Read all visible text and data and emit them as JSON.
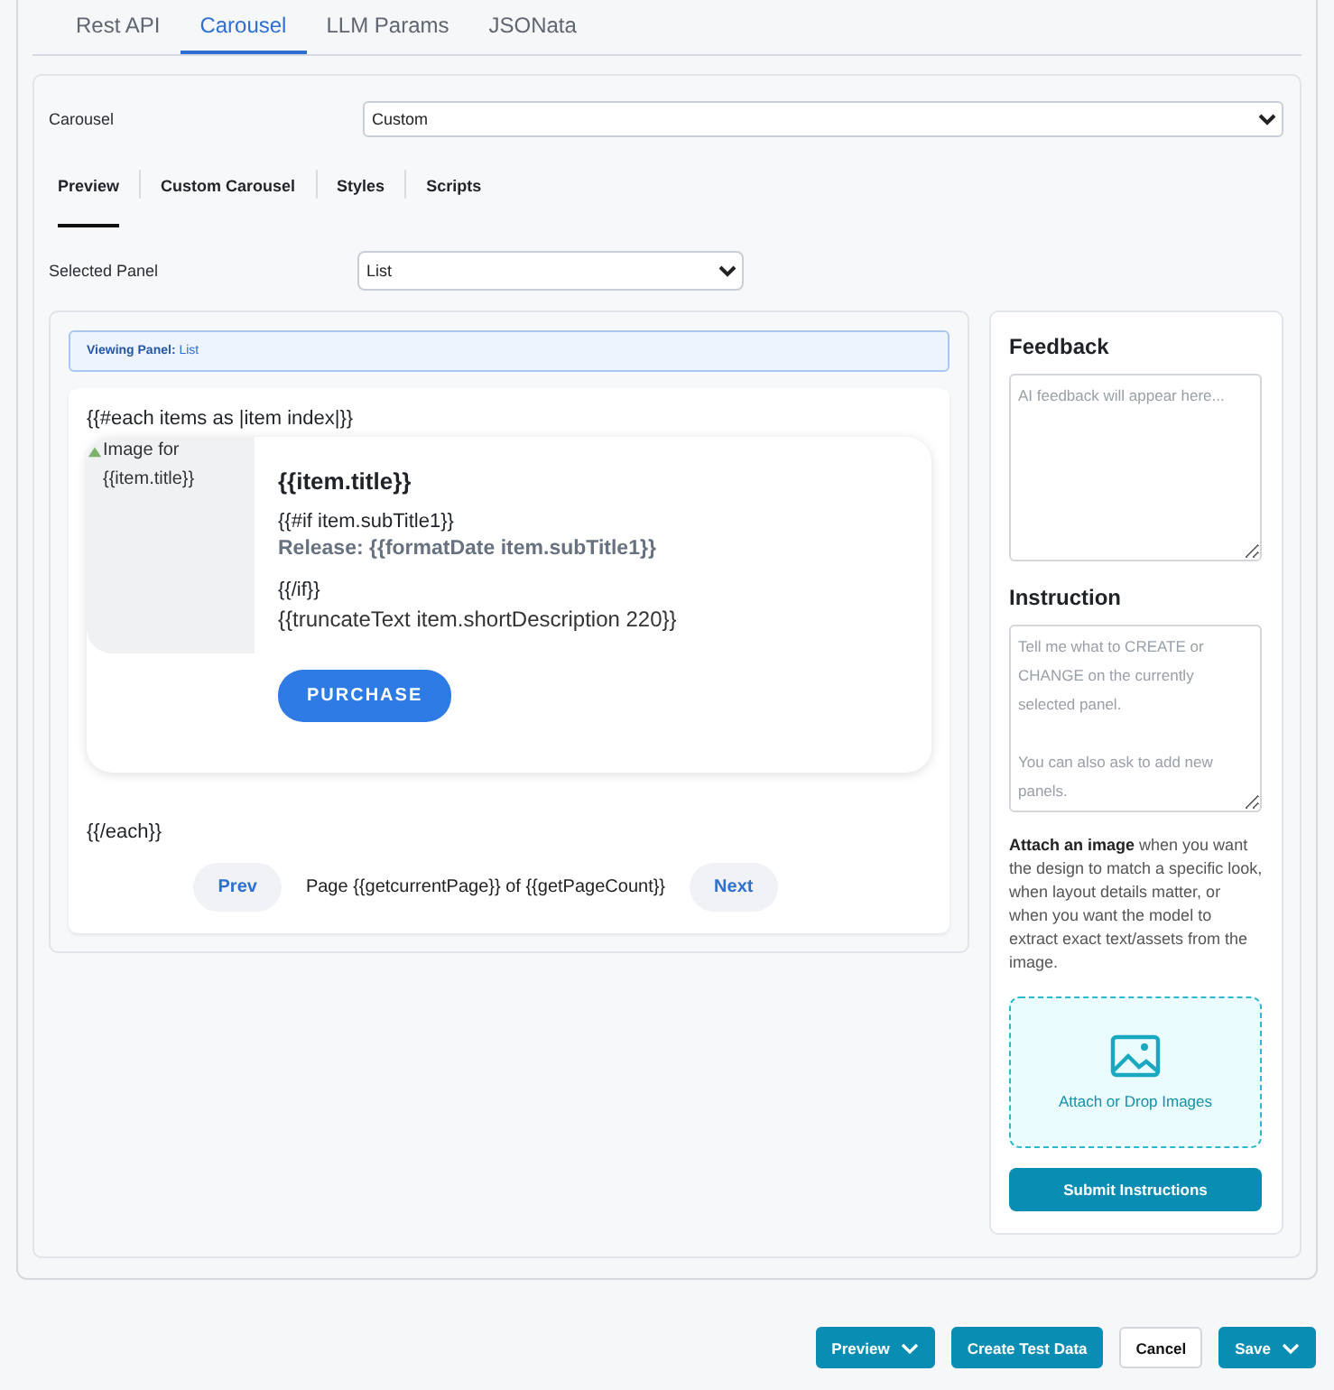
{
  "top_tabs": [
    {
      "label": "Rest API",
      "selected": false
    },
    {
      "label": "Carousel",
      "selected": true
    },
    {
      "label": "LLM Params",
      "selected": false
    },
    {
      "label": "JSONata",
      "selected": false
    }
  ],
  "carousel_field": {
    "label": "Carousel",
    "value": "Custom"
  },
  "sub_tabs": [
    {
      "label": "Preview",
      "selected": true
    },
    {
      "label": "Custom Carousel",
      "selected": false
    },
    {
      "label": "Styles",
      "selected": false
    },
    {
      "label": "Scripts",
      "selected": false
    }
  ],
  "panel_field": {
    "label": "Selected Panel",
    "value": "List"
  },
  "preview": {
    "banner": "**Viewing Panel:** List",
    "each_open": "{{#each items as |item index|}}",
    "image_alt": "Image for {{item.title}}",
    "title": "{{item.title}}",
    "if_open": "{{#if item.subTitle1}}",
    "release": "Release: {{formatDate item.subTitle1}}",
    "if_close": "{{/if}}",
    "description": "{{truncateText item.shortDescription 220}}",
    "button": "PURCHASE",
    "each_close": "{{/each}}",
    "prev": "Prev",
    "page": "Page {{getcurrentPage}} of {{getPageCount}}",
    "next": "Next"
  },
  "feedback": {
    "title": "Feedback",
    "placeholder": "AI feedback will appear here..."
  },
  "instruction": {
    "title": "Instruction",
    "placeholder": "Tell me what to CREATE or CHANGE on the currently selected panel.\n\nYou can also ask to add new panels."
  },
  "attach_note": "**Attach an image** when you want the design to match a specific look, when layout details matter, or when you want the model to extract exact text/assets from the image.",
  "dropzone": "Attach or Drop Images",
  "submit": "Submit Instructions",
  "footer": [
    {
      "label": "Preview",
      "kind": "dropdown"
    },
    {
      "label": "Create Test Data",
      "kind": "primary"
    },
    {
      "label": "Cancel",
      "kind": "plain"
    },
    {
      "label": "Save",
      "kind": "dropdown"
    }
  ]
}
